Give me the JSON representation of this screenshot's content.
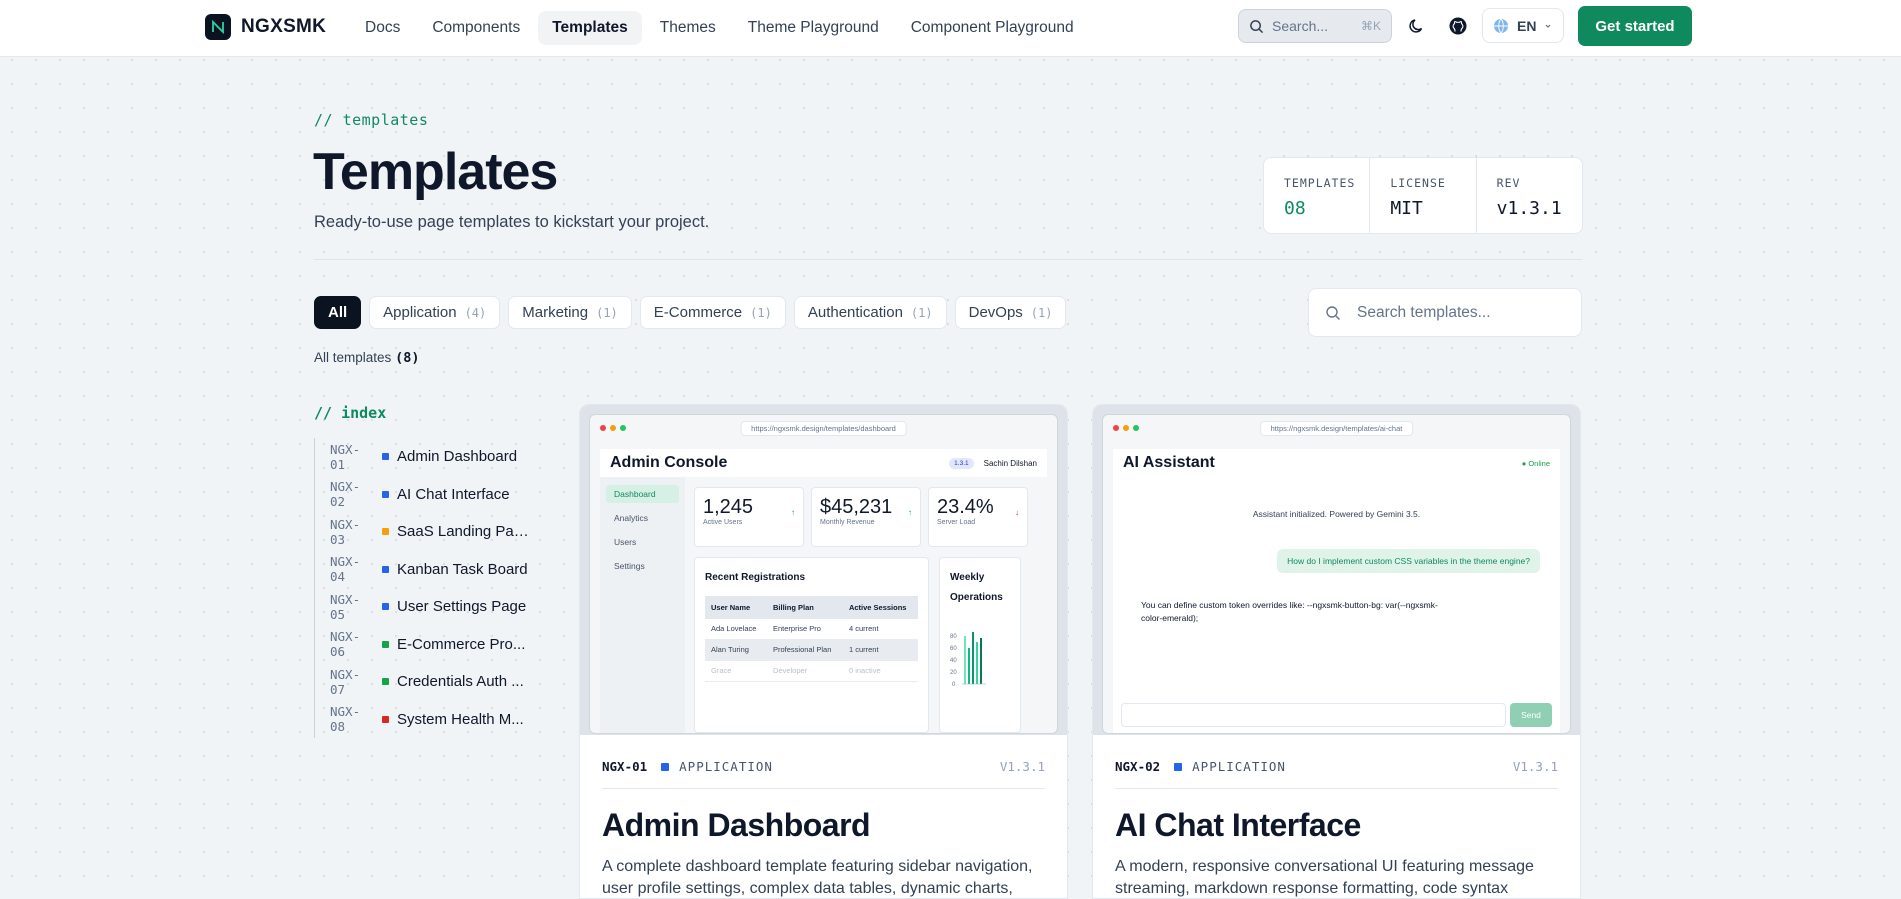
{
  "nav": {
    "brand": "NGXSMK",
    "links": [
      "Docs",
      "Components",
      "Templates",
      "Themes",
      "Theme Playground",
      "Component Playground"
    ],
    "active_link": "Templates",
    "search_label": "Search...",
    "search_kbd": "⌘K",
    "lang": "EN",
    "cta": "Get started"
  },
  "header": {
    "eyebrow": "// templates",
    "title": "Templates",
    "subtitle": "Ready-to-use page templates to kickstart your project.",
    "meta": [
      {
        "label": "TEMPLATES",
        "value": "08"
      },
      {
        "label": "LICENSE",
        "value": "MIT"
      },
      {
        "label": "REV",
        "value": "v1.3.1"
      }
    ]
  },
  "filters": {
    "chips": [
      {
        "label": "All",
        "count": ""
      },
      {
        "label": "Application",
        "count": "(4)"
      },
      {
        "label": "Marketing",
        "count": "(1)"
      },
      {
        "label": "E-Commerce",
        "count": "(1)"
      },
      {
        "label": "Authentication",
        "count": "(1)"
      },
      {
        "label": "DevOps",
        "count": "(1)"
      }
    ],
    "search_placeholder": "Search templates...",
    "count_label": "All templates",
    "count_value": "(8)"
  },
  "index": {
    "title": "// index",
    "items": [
      {
        "code": "NGX-01",
        "name": "Admin Dashboard",
        "color": "#2563eb"
      },
      {
        "code": "NGX-02",
        "name": "AI Chat Interface",
        "color": "#2563eb"
      },
      {
        "code": "NGX-03",
        "name": "SaaS Landing Page",
        "color": "#f59e0b"
      },
      {
        "code": "NGX-04",
        "name": "Kanban Task Board",
        "color": "#2563eb"
      },
      {
        "code": "NGX-05",
        "name": "User Settings Page",
        "color": "#2563eb"
      },
      {
        "code": "NGX-06",
        "name": "E-Commerce Pro...",
        "color": "#16a34a"
      },
      {
        "code": "NGX-07",
        "name": "Credentials Auth ...",
        "color": "#16a34a"
      },
      {
        "code": "NGX-08",
        "name": "System Health M...",
        "color": "#dc2626"
      }
    ]
  },
  "cards": [
    {
      "code": "NGX-01",
      "category": "APPLICATION",
      "version": "V1.3.1",
      "title": "Admin Dashboard",
      "desc": "A complete dashboard template featuring sidebar navigation, user profile settings, complex data tables, dynamic charts,",
      "preview": {
        "url": "https://ngxsmk.design/templates/dashboard",
        "title": "Admin Console",
        "badge": "1.3.1",
        "user": "Sachin Dilshan",
        "sidebar": [
          "Dashboard",
          "Analytics",
          "Users",
          "Settings"
        ],
        "stats": [
          {
            "value": "1,245",
            "label": "Active Users",
            "arrow": "↑"
          },
          {
            "value": "$45,231",
            "label": "Monthly Revenue",
            "arrow": "↑"
          },
          {
            "value": "23.4%",
            "label": "Server Load",
            "arrow": "↓"
          }
        ],
        "table_title": "Recent Registrations",
        "table_headers": [
          "User Name",
          "Billing Plan",
          "Active Sessions"
        ],
        "table_rows": [
          [
            "Ada Lovelace",
            "Enterprise Pro",
            "4 current"
          ],
          [
            "Alan Turing",
            "Professional Plan",
            "1 current"
          ],
          [
            "Grace",
            "Developer",
            "0 inactive"
          ]
        ],
        "chart_title": "Weekly Operations",
        "chart_ticks": [
          "80",
          "60",
          "40",
          "20",
          "0"
        ]
      }
    },
    {
      "code": "NGX-02",
      "category": "APPLICATION",
      "version": "V1.3.1",
      "title": "AI Chat Interface",
      "desc": "A modern, responsive conversational UI featuring message streaming, markdown response formatting, code syntax",
      "preview": {
        "url": "https://ngxsmk.design/templates/ai-chat",
        "title": "AI Assistant",
        "status": "● Online",
        "system_msg": "Assistant initialized. Powered by Gemini 3.5.",
        "user_msg": "How do I implement custom CSS variables in the theme engine?",
        "bot_msg": "You can define custom token overrides like: --ngxsmk-button-bg: var(--ngxsmk-color-emerald);",
        "send": "Send"
      }
    }
  ],
  "colors": {
    "accent": "#0f8a5f",
    "dark": "#0b1220",
    "application": "#2563eb"
  }
}
